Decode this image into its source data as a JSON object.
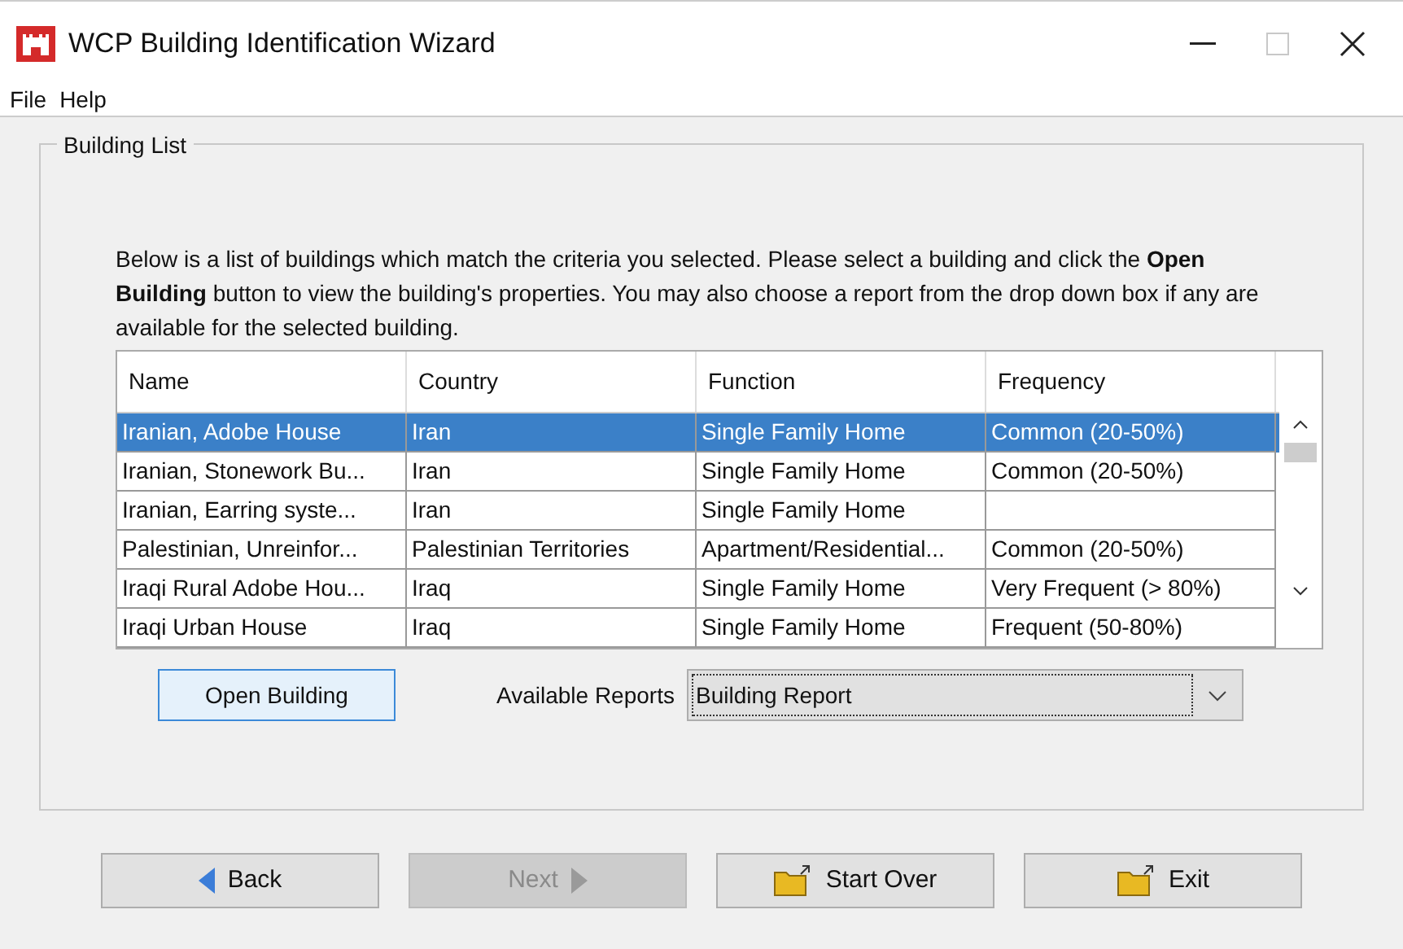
{
  "window": {
    "title": "WCP Building Identification Wizard",
    "controls": [
      {
        "kind": "minimize"
      },
      {
        "kind": "maximize",
        "disabled": true
      },
      {
        "kind": "close"
      }
    ]
  },
  "menu": [
    "File",
    "Help"
  ],
  "group": {
    "title": "Building List",
    "intro": "Below is a list of buildings which match the criteria you selected. Please select a building and click the **Open Building** button to view the building's properties. You may also choose a report from the drop down box if any are available for the selected building.",
    "table": {
      "columns": [
        "Name",
        "Country",
        "Function",
        "Frequency"
      ],
      "rows": [
        {
          "cells": [
            "Iranian, Adobe House",
            "Iran",
            "Single Family Home",
            "Common (20-50%)"
          ],
          "selected": true
        },
        {
          "cells": [
            "Iranian, Stonework Bu...",
            "Iran",
            "Single Family Home",
            "Common (20-50%)"
          ],
          "selected": false
        },
        {
          "cells": [
            "Iranian, Earring syste...",
            "Iran",
            "Single Family Home",
            ""
          ],
          "selected": false
        },
        {
          "cells": [
            "Palestinian, Unreinfor...",
            "Palestinian Territories",
            "Apartment/Residential...",
            "Common (20-50%)"
          ],
          "selected": false
        },
        {
          "cells": [
            "Iraqi Rural Adobe Hou...",
            "Iraq",
            "Single Family Home",
            "Very Frequent (> 80%)"
          ],
          "selected": false
        },
        {
          "cells": [
            "Iraqi Urban House",
            "Iraq",
            "Single Family Home",
            "Frequent (50-80%)"
          ],
          "selected": false
        }
      ]
    },
    "open_button": "Open Building",
    "reports": {
      "label": "Available Reports",
      "value": "Building Report"
    }
  },
  "nav_buttons": [
    {
      "label": "Back",
      "kind": "back",
      "disabled": false
    },
    {
      "label": "Next",
      "kind": "next",
      "disabled": true
    },
    {
      "label": "Start Over",
      "kind": "folder",
      "disabled": false
    },
    {
      "label": "Exit",
      "kind": "folder",
      "disabled": false
    }
  ]
}
